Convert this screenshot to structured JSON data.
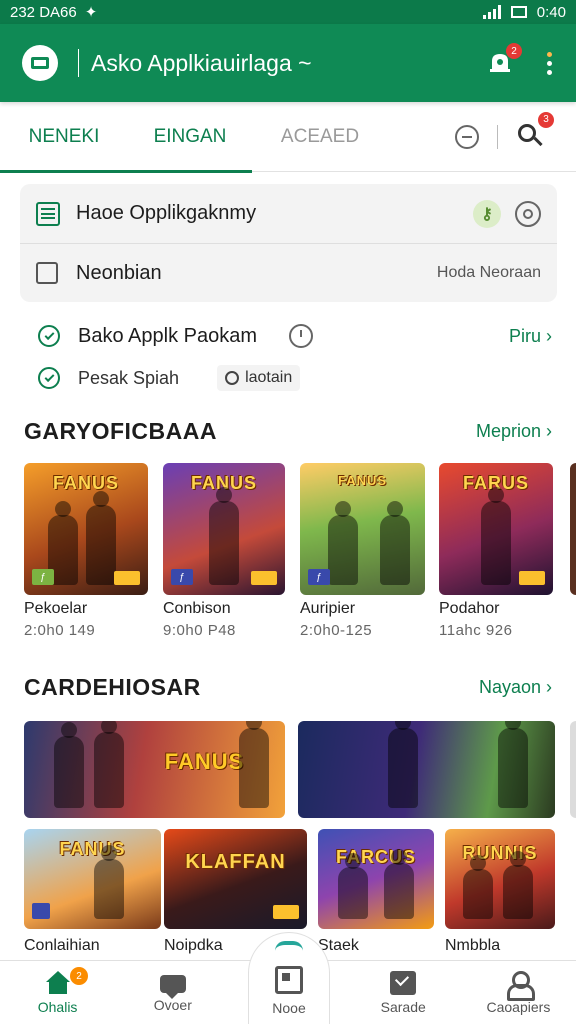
{
  "status_bar": {
    "left_text": "232 DA66",
    "time": "0:40"
  },
  "app_bar": {
    "title": "Asko Applkiauirlaga ~",
    "notification_count": "2",
    "menu_badge_color": "#ffb74d"
  },
  "tabs": [
    {
      "label": "NENEKI",
      "active": true
    },
    {
      "label": "EINGAN",
      "active": true
    },
    {
      "label": "ACEAED",
      "active": false
    }
  ],
  "search_badge": "3",
  "card": {
    "row1_label": "Haoe Opplikgaknmy",
    "row2_label": "Neonbian",
    "row2_note": "Hoda Neoraan"
  },
  "options": {
    "opt1_label": "Bako Applk Paokam",
    "opt1_link": "Piru ›",
    "opt2_label": "Pesak Spiah",
    "opt2_chip": "laotain"
  },
  "section1": {
    "title": "GARYOFICBAAA",
    "link": "Meprion ›",
    "games": [
      {
        "art": "FANUS",
        "name": "Pekoelar",
        "meta": "2:0h0 149"
      },
      {
        "art": "FANUS",
        "name": "Conbison",
        "meta": "9:0h0 P48"
      },
      {
        "art": "FANUS",
        "name": "Auripier",
        "meta": "2:0h0-125"
      },
      {
        "art": "FARUS",
        "name": "Podahor",
        "meta": "11ahc 926"
      }
    ]
  },
  "section2": {
    "title": "CARDEHIOSAR",
    "link": "Nayaon ›",
    "banners": [
      {
        "art": "FANUS"
      },
      {
        "art": ""
      }
    ],
    "games": [
      {
        "art": "FANUS",
        "name": "Conlaihian"
      },
      {
        "art": "KLAFFAN",
        "name": "Noipdka"
      },
      {
        "art": "FARCUS",
        "name": "Staek"
      },
      {
        "art": "RUNNIS",
        "name": "Nmbbla"
      }
    ]
  },
  "bottom_nav": {
    "home": "Ohalis",
    "home_badge": "2",
    "chat": "Ovoer",
    "center": "Nooe",
    "mail": "Sarade",
    "profile": "Caoapiers"
  },
  "colors": {
    "primary": "#0f8a55",
    "accent": "#0d7f4f",
    "badge": "#e53935"
  }
}
